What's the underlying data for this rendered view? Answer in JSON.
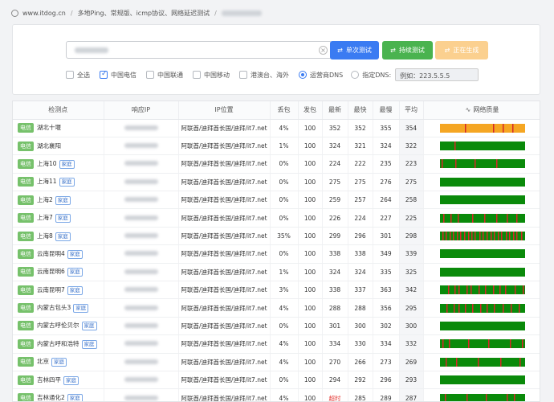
{
  "breadcrumb": {
    "home": "www.itdog.cn",
    "separator": "/",
    "section": "多地Ping、常规版、icmp协议、网络延迟测试"
  },
  "search": {
    "clear_icon": "close-circle-icon",
    "single_test": "单次测试",
    "continuous_test": "持续测试",
    "generating": "正在生成",
    "colors": {
      "single": "#3a7bf2",
      "continuous": "#4ab34f",
      "generating": "#fbd08f"
    }
  },
  "filters": {
    "isp_options": [
      {
        "label": "全选",
        "checked": false
      },
      {
        "label": "中国电信",
        "checked": true
      },
      {
        "label": "中国联通",
        "checked": false
      },
      {
        "label": "中国移动",
        "checked": false
      },
      {
        "label": "港澳台、海外",
        "checked": false
      }
    ],
    "dns_operator": "运营商DNS",
    "dns_custom": "指定DNS:",
    "dns_custom_value": "例如：223.5.5.5",
    "dns_operator_selected": true
  },
  "table": {
    "headers": [
      "检测点",
      "响应IP",
      "IP位置",
      "丢包",
      "发包",
      "最新",
      "最快",
      "最慢",
      "平均",
      "网络质量"
    ],
    "quality_colors": {
      "good": "#0a8a0a",
      "warn": "#f5a623",
      "loss": "#d62828"
    },
    "rows": [
      {
        "isp": "电信",
        "node": "湖北十堰",
        "home": "",
        "location": "阿联酋/迪拜酋长国/迪拜/it7.net",
        "loss": "4%",
        "sent": "100",
        "latest": "352",
        "fastest": "352",
        "slowest": "355",
        "avg": "354",
        "quality": {
          "base": "warn",
          "marks": [
            0.29,
            0.62,
            0.74,
            0.85
          ]
        }
      },
      {
        "isp": "电信",
        "node": "湖北襄阳",
        "home": "",
        "location": "阿联酋/迪拜酋长国/迪拜/it7.net",
        "loss": "1%",
        "sent": "100",
        "latest": "324",
        "fastest": "321",
        "slowest": "324",
        "avg": "322",
        "quality": {
          "base": "good",
          "marks": [
            0.17
          ]
        }
      },
      {
        "isp": "电信",
        "node": "上海10",
        "home": "家庭",
        "location": "阿联酋/迪拜酋长国/迪拜/it7.net",
        "loss": "0%",
        "sent": "100",
        "latest": "224",
        "fastest": "222",
        "slowest": "235",
        "avg": "223",
        "quality": {
          "base": "good",
          "marks": [
            0.02,
            0.18,
            0.41,
            0.66
          ]
        }
      },
      {
        "isp": "电信",
        "node": "上海11",
        "home": "家庭",
        "location": "阿联酋/迪拜酋长国/迪拜/it7.net",
        "loss": "0%",
        "sent": "100",
        "latest": "275",
        "fastest": "275",
        "slowest": "276",
        "avg": "275",
        "quality": {
          "base": "good",
          "marks": []
        }
      },
      {
        "isp": "电信",
        "node": "上海2",
        "home": "家庭",
        "location": "阿联酋/迪拜酋长国/迪拜/it7.net",
        "loss": "0%",
        "sent": "100",
        "latest": "259",
        "fastest": "257",
        "slowest": "264",
        "avg": "258",
        "quality": {
          "base": "good",
          "marks": []
        }
      },
      {
        "isp": "电信",
        "node": "上海7",
        "home": "家庭",
        "location": "阿联酋/迪拜酋长国/迪拜/it7.net",
        "loss": "0%",
        "sent": "100",
        "latest": "226",
        "fastest": "224",
        "slowest": "227",
        "avg": "225",
        "quality": {
          "base": "good",
          "marks": [
            0.04,
            0.12,
            0.21,
            0.38,
            0.52,
            0.66,
            0.78,
            0.9
          ]
        }
      },
      {
        "isp": "电信",
        "node": "上海8",
        "home": "家庭",
        "location": "阿联酋/迪拜酋长国/迪拜/it7.net",
        "loss": "35%",
        "sent": "100",
        "latest": "299",
        "fastest": "296",
        "slowest": "301",
        "avg": "298",
        "quality": {
          "base": "good",
          "marks": [
            0.03,
            0.07,
            0.11,
            0.15,
            0.2,
            0.24,
            0.28,
            0.33,
            0.37,
            0.41,
            0.46,
            0.5,
            0.55,
            0.59,
            0.63,
            0.68,
            0.72,
            0.77,
            0.81,
            0.86,
            0.9,
            0.95
          ]
        }
      },
      {
        "isp": "电信",
        "node": "云南昆明4",
        "home": "家庭",
        "location": "阿联酋/迪拜酋长国/迪拜/it7.net",
        "loss": "0%",
        "sent": "100",
        "latest": "338",
        "fastest": "338",
        "slowest": "349",
        "avg": "339",
        "quality": {
          "base": "good",
          "marks": []
        }
      },
      {
        "isp": "电信",
        "node": "云南昆明6",
        "home": "家庭",
        "location": "阿联酋/迪拜酋长国/迪拜/it7.net",
        "loss": "1%",
        "sent": "100",
        "latest": "324",
        "fastest": "324",
        "slowest": "335",
        "avg": "325",
        "quality": {
          "base": "good",
          "marks": []
        }
      },
      {
        "isp": "电信",
        "node": "云南昆明7",
        "home": "家庭",
        "location": "阿联酋/迪拜酋长国/迪拜/it7.net",
        "loss": "3%",
        "sent": "100",
        "latest": "338",
        "fastest": "337",
        "slowest": "363",
        "avg": "342",
        "quality": {
          "base": "good",
          "marks": [
            0.09,
            0.17,
            0.22,
            0.31,
            0.36,
            0.45,
            0.53,
            0.62,
            0.7,
            0.76,
            0.88,
            0.97
          ]
        }
      },
      {
        "isp": "电信",
        "node": "内蒙古包头3",
        "home": "家庭",
        "location": "阿联酋/迪拜酋长国/迪拜/it7.net",
        "loss": "4%",
        "sent": "100",
        "latest": "288",
        "fastest": "288",
        "slowest": "356",
        "avg": "295",
        "quality": {
          "base": "good",
          "marks": [
            0.08,
            0.16,
            0.22,
            0.29,
            0.38,
            0.47,
            0.55,
            0.63,
            0.74,
            0.83,
            0.92
          ]
        }
      },
      {
        "isp": "电信",
        "node": "内蒙古呼伦贝尔",
        "home": "家庭",
        "location": "阿联酋/迪拜酋长国/迪拜/it7.net",
        "loss": "0%",
        "sent": "100",
        "latest": "301",
        "fastest": "300",
        "slowest": "302",
        "avg": "300",
        "quality": {
          "base": "good",
          "marks": []
        }
      },
      {
        "isp": "电信",
        "node": "内蒙古呼和浩特",
        "home": "家庭",
        "location": "阿联酋/迪拜酋长国/迪拜/it7.net",
        "loss": "4%",
        "sent": "100",
        "latest": "334",
        "fastest": "330",
        "slowest": "334",
        "avg": "332",
        "quality": {
          "base": "good",
          "marks": [
            0.03,
            0.1,
            0.33,
            0.57,
            0.82,
            0.96
          ]
        }
      },
      {
        "isp": "电信",
        "node": "北京",
        "home": "家庭",
        "location": "阿联酋/迪拜酋长国/迪拜/it7.net",
        "loss": "4%",
        "sent": "100",
        "latest": "270",
        "fastest": "266",
        "slowest": "273",
        "avg": "269",
        "quality": {
          "base": "good",
          "marks": [
            0.07,
            0.19,
            0.44,
            0.71,
            0.93
          ]
        }
      },
      {
        "isp": "电信",
        "node": "吉林四平",
        "home": "家庭",
        "location": "阿联酋/迪拜酋长国/迪拜/it7.net",
        "loss": "0%",
        "sent": "100",
        "latest": "294",
        "fastest": "292",
        "slowest": "296",
        "avg": "293",
        "quality": {
          "base": "good",
          "marks": []
        }
      },
      {
        "isp": "电信",
        "node": "吉林通化2",
        "home": "家庭",
        "location": "阿联酋/迪拜酋长国/迪拜/it7.net",
        "loss": "4%",
        "sent": "100",
        "latest": "超时",
        "fastest": "285",
        "slowest": "289",
        "avg": "287",
        "quality": {
          "base": "good",
          "marks": [
            0.06,
            0.31,
            0.54,
            0.78,
            0.87
          ]
        }
      }
    ]
  }
}
